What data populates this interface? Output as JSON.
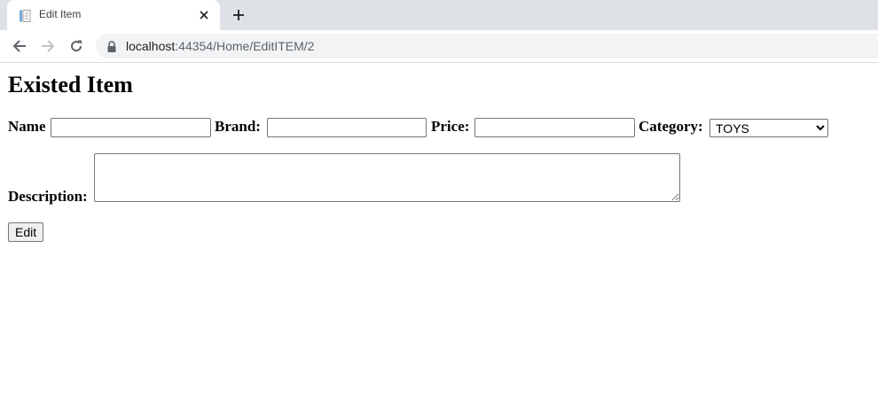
{
  "browser": {
    "tab_title": "Edit Item",
    "url_host": "localhost",
    "url_path": ":44354/Home/EditITEM/2",
    "tab_icon": "document-icon",
    "colors": {
      "tabstrip": "#dee1e6",
      "omnibox": "#f1f3f4"
    }
  },
  "page": {
    "title": "Existed Item",
    "form": {
      "name_label": "Name",
      "name_value": "",
      "brand_label": "Brand:",
      "brand_value": "",
      "price_label": "Price:",
      "price_value": "",
      "category_label": "Category:",
      "category_selected": "TOYS",
      "description_label": "Description:",
      "description_value": "",
      "submit_label": "Edit"
    }
  }
}
